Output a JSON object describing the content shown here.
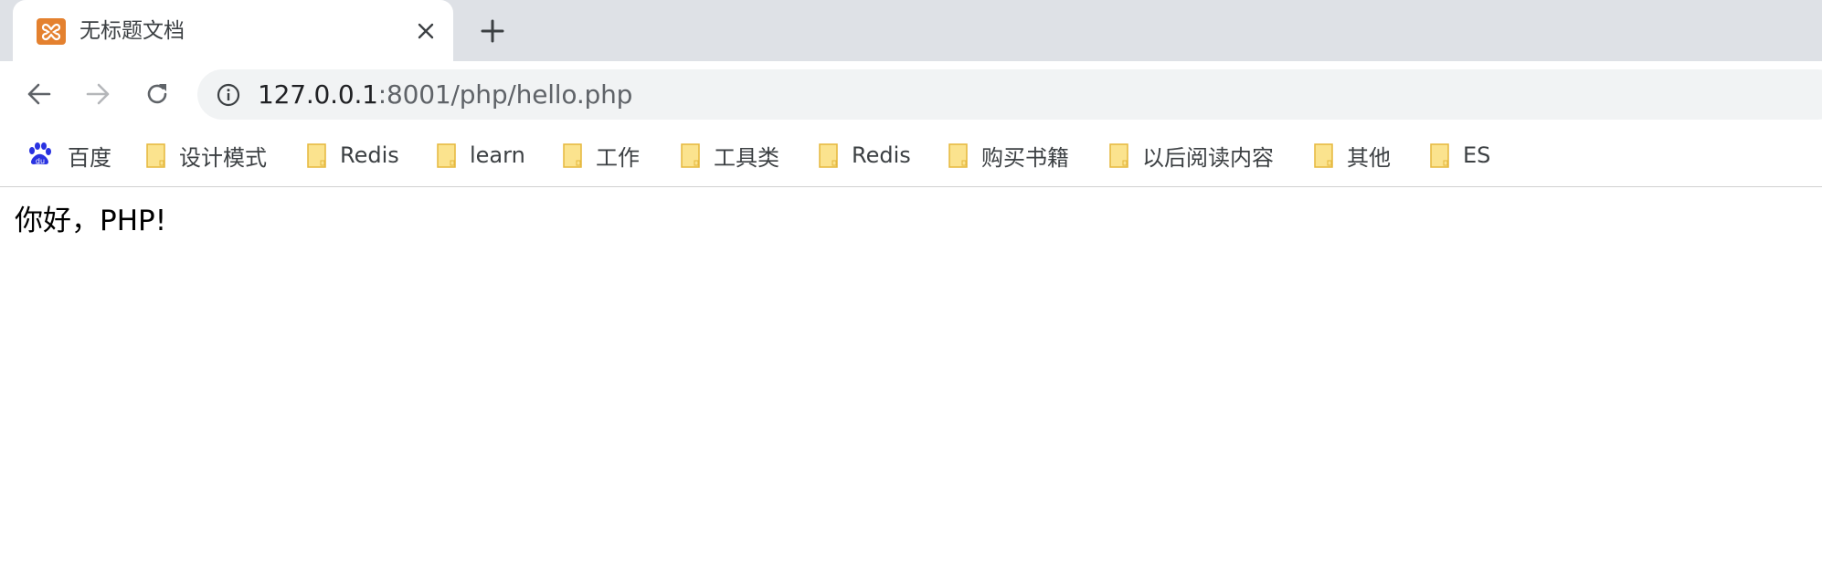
{
  "tab": {
    "title": "无标题文档",
    "favicon": "xampp-icon",
    "close_icon": "close-icon"
  },
  "toolbar": {
    "back_icon": "back-arrow-icon",
    "forward_icon": "forward-arrow-icon",
    "reload_icon": "reload-icon",
    "url_host": "127.0.0.1",
    "url_rest": ":8001/php/hello.php",
    "info_icon": "info-icon"
  },
  "bookmarks": [
    {
      "label": "百度",
      "icon": "baidu-icon"
    },
    {
      "label": "设计模式",
      "icon": "folder-icon"
    },
    {
      "label": "Redis",
      "icon": "folder-icon"
    },
    {
      "label": "learn",
      "icon": "folder-icon"
    },
    {
      "label": "工作",
      "icon": "folder-icon"
    },
    {
      "label": "工具类",
      "icon": "folder-icon"
    },
    {
      "label": "Redis",
      "icon": "folder-icon"
    },
    {
      "label": "购买书籍",
      "icon": "folder-icon"
    },
    {
      "label": "以后阅读内容",
      "icon": "folder-icon"
    },
    {
      "label": "其他",
      "icon": "folder-icon"
    },
    {
      "label": "ES",
      "icon": "folder-icon"
    }
  ],
  "page": {
    "text": "你好，PHP!"
  },
  "colors": {
    "tabstrip_bg": "#dee1e6",
    "omnibox_bg": "#f1f3f4",
    "favicon_orange": "#e4812f",
    "folder_yellow": "#f9dc7e",
    "baidu_blue": "#2932e1"
  }
}
